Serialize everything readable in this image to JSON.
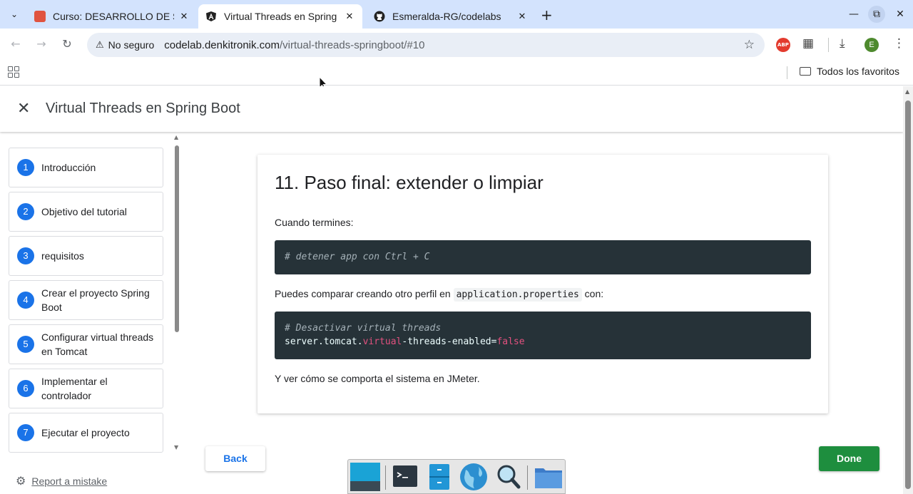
{
  "browser": {
    "tabs": [
      {
        "title": "Curso: DESARROLLO DE S",
        "active": false
      },
      {
        "title": "Virtual Threads en Spring",
        "active": true
      },
      {
        "title": "Esmeralda-RG/codelabs",
        "active": false
      }
    ],
    "new_tab_label": "+",
    "security_label": "No seguro",
    "url_host": "codelab.denkitronik.com",
    "url_path": "/virtual-threads-springboot/#10",
    "abp_label": "ABP",
    "profile_initial": "E",
    "bookmarks_folder": "Todos los favoritos"
  },
  "codelab": {
    "title": "Virtual Threads en Spring Boot",
    "steps": [
      {
        "num": "1",
        "label": "Introducción"
      },
      {
        "num": "2",
        "label": "Objetivo del tutorial"
      },
      {
        "num": "3",
        "label": "requisitos"
      },
      {
        "num": "4",
        "label": "Crear el proyecto Spring Boot"
      },
      {
        "num": "5",
        "label": "Configurar virtual threads en Tomcat"
      },
      {
        "num": "6",
        "label": "Implementar el controlador"
      },
      {
        "num": "7",
        "label": "Ejecutar el proyecto"
      }
    ],
    "report_label": "Report a mistake",
    "card": {
      "heading": "11. Paso final: extender o limpiar",
      "p1": "Cuando termines:",
      "code1": "# detener app con Ctrl + C",
      "p2_before": "Puedes comparar creando otro perfil en",
      "p2_code": "application.properties",
      "p2_after": "con:",
      "code2_comment": "# Desactivar virtual threads",
      "code2_a": "server.tomcat.",
      "code2_kw1": "virtual",
      "code2_b": "-threads-enabled=",
      "code2_kw2": "false",
      "p3": "Y ver cómo se comporta el sistema en JMeter."
    },
    "back_label": "Back",
    "done_label": "Done"
  },
  "colors": {
    "accent": "#1a73e8",
    "done": "#1e8e3e",
    "code_bg": "#263238",
    "tabbar": "#d3e3fd"
  }
}
